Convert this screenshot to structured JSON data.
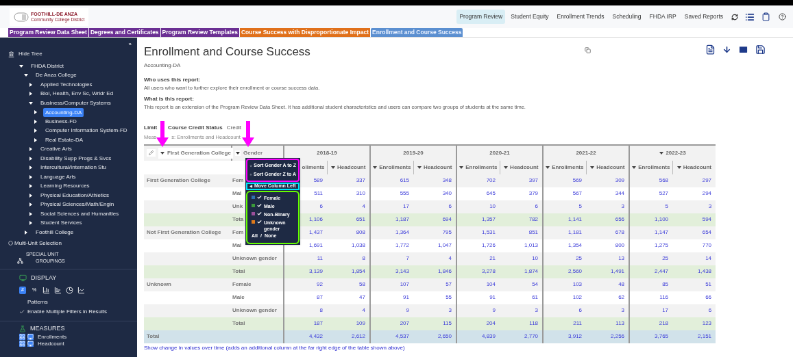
{
  "logo": {
    "title": "FOOTHILL-DE ANZA",
    "subtitle": "Community College District"
  },
  "nav": [
    {
      "label": "Program Review",
      "selected": true
    },
    {
      "label": "Student Equity",
      "selected": false
    },
    {
      "label": "Enrollment Trends",
      "selected": false
    },
    {
      "label": "Scheduling",
      "selected": false
    },
    {
      "label": "FHDA IRP",
      "selected": false
    },
    {
      "label": "Saved Reports",
      "selected": false
    }
  ],
  "tabs": [
    {
      "label": "Program Review Data Sheet",
      "color": "#6b2f93",
      "selected": false
    },
    {
      "label": "Degrees and Certificates",
      "color": "#6b2f93",
      "selected": false
    },
    {
      "label": "Program Review Templates",
      "color": "#6b2f93",
      "selected": false
    },
    {
      "label": "Course Success with Disproportionate Impact",
      "color": "#e0701a",
      "selected": false
    },
    {
      "label": "Enrollment and Course Success",
      "color": "#5b8fd0",
      "selected": true
    }
  ],
  "sidebar": {
    "collapse": "»",
    "hide_tree": "Hide Tree",
    "tree": [
      {
        "label": "FHDA District",
        "expanded": true,
        "selected": false,
        "children": [
          {
            "label": "De Anza College",
            "expanded": true,
            "selected": false,
            "children": [
              {
                "label": "Applied Technologies",
                "expanded": false,
                "selected": false
              },
              {
                "label": "Biol, Health, Env Sc, Wrldr Ed",
                "expanded": false,
                "selected": false
              },
              {
                "label": "Business/Computer Systems",
                "expanded": true,
                "selected": false,
                "children": [
                  {
                    "label": "Accounting-DA",
                    "expanded": false,
                    "selected": true
                  },
                  {
                    "label": "Business-FD",
                    "expanded": false,
                    "selected": false
                  },
                  {
                    "label": "Computer Information System-FD",
                    "expanded": false,
                    "selected": false
                  },
                  {
                    "label": "Real Estate-DA",
                    "expanded": false,
                    "selected": false
                  }
                ]
              },
              {
                "label": "Creative Arts",
                "expanded": false,
                "selected": false
              },
              {
                "label": "Disability Supp Progs & Svcs",
                "expanded": false,
                "selected": false
              },
              {
                "label": "Intercultural/Internation Stu",
                "expanded": false,
                "selected": false
              },
              {
                "label": "Language Arts",
                "expanded": false,
                "selected": false
              },
              {
                "label": "Learning Resources",
                "expanded": false,
                "selected": false
              },
              {
                "label": "Physical Education/Athletics",
                "expanded": false,
                "selected": false
              },
              {
                "label": "Physical Sciences/Math/Engin",
                "expanded": false,
                "selected": false
              },
              {
                "label": "Social Sciences and Humanities",
                "expanded": false,
                "selected": false
              },
              {
                "label": "Student Services",
                "expanded": false,
                "selected": false
              }
            ]
          },
          {
            "label": "Foothill College",
            "expanded": false,
            "selected": false
          }
        ]
      }
    ],
    "multi_unit": {
      "label": "Multi-Unit Selection",
      "selected": false
    },
    "special_groupings": "SPECIAL UNIT GROUPINGS",
    "display": {
      "title": "DISPLAY",
      "options": [
        {
          "kind": "number",
          "label": "#",
          "selected": true
        },
        {
          "kind": "percent",
          "label": "%",
          "selected": false
        },
        {
          "kind": "column",
          "selected": false
        },
        {
          "kind": "bar",
          "selected": false
        },
        {
          "kind": "pie",
          "selected": false
        },
        {
          "kind": "line",
          "selected": false
        }
      ],
      "patterns": "Patterns",
      "multi_filter": {
        "label": "Enable Multiple Filters in Results",
        "checked": true
      }
    },
    "measures": {
      "title": "MEASURES",
      "items": [
        "Enrollments",
        "Headcount"
      ]
    }
  },
  "report": {
    "title": "Enrollment and Course Success",
    "unit": "Accounting-DA",
    "who_heading": "Who uses this report:",
    "who_text": "All users who want to further explore their enrollment or course success data.",
    "what_heading": "What is this report:",
    "what_text": "This report is an extension of the Program Review Data Sheet. It has additional student characteristics and users can compare two groups of students at the same time.",
    "filter_label": "Limit",
    "filter_name": "Course Credit Status",
    "filter_value": "Credit",
    "measures_start": "Meas",
    "measures_rest": "s: Enrollments and Headcount",
    "footer_link": "Show change in values over time (adds an additional column at the far right edge of the table shown above)"
  },
  "table": {
    "row_field": "First Generation College",
    "col_field": "Gender",
    "years": [
      {
        "label": "2018-19",
        "menu": false
      },
      {
        "label": "2019-20",
        "menu": false
      },
      {
        "label": "2020-21",
        "menu": false
      },
      {
        "label": "2021-22",
        "menu": false
      },
      {
        "label": "2022-23",
        "menu": true
      }
    ],
    "measures": [
      {
        "label": "ollments",
        "menu": false
      },
      {
        "label": "Headcount",
        "menu": true
      },
      {
        "label": "Enrollments",
        "menu": true
      },
      {
        "label": "Headcount",
        "menu": true
      },
      {
        "label": "Enrollments",
        "menu": true
      },
      {
        "label": "Headcount",
        "menu": true
      },
      {
        "label": "Enrollments",
        "menu": true
      },
      {
        "label": "Headcount",
        "menu": true
      },
      {
        "label": "Enrollments",
        "menu": true
      },
      {
        "label": "Headcount",
        "menu": true
      }
    ],
    "rows": [
      {
        "kind": "data",
        "group": "First Generation College",
        "gender": "Fem",
        "values": [
          "589",
          "337",
          "615",
          "348",
          "702",
          "397",
          "569",
          "309",
          "568",
          "297"
        ]
      },
      {
        "kind": "data",
        "gender": "Mal",
        "values": [
          "511",
          "310",
          "555",
          "340",
          "645",
          "379",
          "567",
          "344",
          "527",
          "294"
        ]
      },
      {
        "kind": "data",
        "gender": "Unk",
        "values": [
          "6",
          "4",
          "17",
          "6",
          "10",
          "6",
          "5",
          "3",
          "5",
          "3"
        ]
      },
      {
        "kind": "total",
        "gender": "Tota",
        "values": [
          "1,106",
          "651",
          "1,187",
          "694",
          "1,357",
          "782",
          "1,141",
          "656",
          "1,100",
          "594"
        ]
      },
      {
        "kind": "data",
        "group": "Not First Generation College",
        "gender": "Fem",
        "values": [
          "1,437",
          "808",
          "1,364",
          "795",
          "1,531",
          "851",
          "1,181",
          "678",
          "1,147",
          "654"
        ]
      },
      {
        "kind": "data",
        "gender": "Mal",
        "values": [
          "1,691",
          "1,038",
          "1,772",
          "1,047",
          "1,726",
          "1,013",
          "1,354",
          "800",
          "1,275",
          "770"
        ]
      },
      {
        "kind": "data",
        "gender": "Unknown gender",
        "values": [
          "11",
          "8",
          "7",
          "4",
          "21",
          "10",
          "25",
          "13",
          "25",
          "14"
        ]
      },
      {
        "kind": "total",
        "gender": "Total",
        "values": [
          "3,139",
          "1,854",
          "3,143",
          "1,846",
          "3,278",
          "1,874",
          "2,560",
          "1,491",
          "2,447",
          "1,438"
        ]
      },
      {
        "kind": "data",
        "group": "Unknown",
        "gender": "Female",
        "values": [
          "92",
          "58",
          "107",
          "57",
          "104",
          "54",
          "103",
          "48",
          "85",
          "51"
        ]
      },
      {
        "kind": "data",
        "gender": "Male",
        "values": [
          "87",
          "47",
          "91",
          "55",
          "91",
          "61",
          "102",
          "62",
          "116",
          "66"
        ]
      },
      {
        "kind": "data",
        "gender": "Unknown gender",
        "values": [
          "8",
          "4",
          "9",
          "3",
          "9",
          "3",
          "6",
          "3",
          "17",
          "6"
        ]
      },
      {
        "kind": "total",
        "gender": "Total",
        "values": [
          "187",
          "109",
          "207",
          "115",
          "204",
          "118",
          "211",
          "113",
          "218",
          "123"
        ]
      },
      {
        "kind": "grand",
        "group": "Total",
        "values": [
          "4,432",
          "2,612",
          "4,537",
          "2,650",
          "4,839",
          "2,770",
          "3,912",
          "2,256",
          "3,765",
          "2,151"
        ]
      }
    ]
  },
  "gender_menu": {
    "sort": [
      {
        "kind": "down",
        "label": "Sort Gender A to Z"
      },
      {
        "kind": "up",
        "label": "Sort Gender Z to A"
      }
    ],
    "move": "Move Column Left",
    "filters": [
      {
        "label": "Female",
        "color": "#2f6fb0",
        "checked": true
      },
      {
        "label": "Male",
        "color": "#3a9a3a",
        "checked": true
      },
      {
        "label": "Non-Binary",
        "color": "#9b4f9b",
        "checked": true
      },
      {
        "label": "Unknown gender",
        "color": "#e07a1a",
        "checked": true
      }
    ],
    "all": "All",
    "separator": "/",
    "none": "None"
  }
}
